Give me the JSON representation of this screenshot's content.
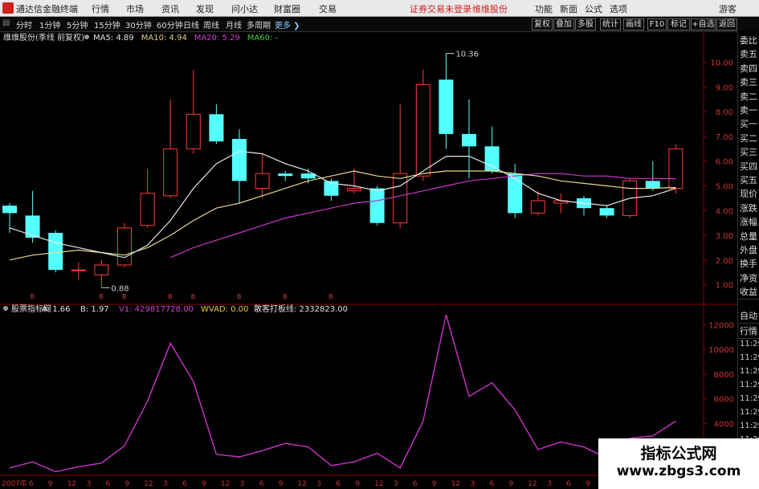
{
  "titlebar": {
    "app_name": "通达信金融终端",
    "menu": [
      "行情",
      "市场",
      "资讯",
      "发现",
      "问小达",
      "财富圈",
      "交易"
    ],
    "notice": "证券交易未登录",
    "stock_link": "维维股份",
    "right_menu": [
      "功能",
      "新面",
      "公式",
      "选项"
    ],
    "guest": "游客"
  },
  "toolbar": {
    "periods": [
      "分时",
      "1分钟",
      "5分钟",
      "15分钟",
      "30分钟",
      "60分钟",
      "日线",
      "周线",
      "月线",
      "多周期"
    ],
    "more": "更多",
    "right_buttons": [
      "复权",
      "叠加",
      "多股",
      "统计",
      "画线",
      "F10",
      "标记",
      "+自选",
      "返回"
    ]
  },
  "main_panel": {
    "legend": [
      {
        "text": "维维股份(季线 前复权)",
        "color": "#dddddd"
      },
      {
        "text": "MA5: 4.89",
        "color": "#e0e0e0"
      },
      {
        "text": "MA10: 4.94",
        "color": "#e0d080"
      },
      {
        "text": "MA20: 5.29",
        "color": "#d040d0"
      },
      {
        "text": "MA60: -",
        "color": "#40d040"
      }
    ],
    "max_label": "10.36",
    "min_label": "0.88",
    "markers": [
      1,
      4,
      5,
      7,
      8,
      10,
      12,
      14
    ],
    "colors": {
      "up": "#ff3c3c",
      "down": "#54ffff",
      "ma5": "#e6e6e6",
      "ma10": "#e6d88a",
      "ma20": "#cc33cc"
    }
  },
  "sub_panel": {
    "legend": [
      {
        "text": "股票指标网",
        "color": "#dddddd"
      },
      {
        "text": "A: 1.66",
        "color": "#e0e0e0"
      },
      {
        "text": "B: 1.97",
        "color": "#e0e0e0"
      },
      {
        "text": "V1: 429817728.00",
        "color": "#d040d0"
      },
      {
        "text": "WVAD: 0.00",
        "color": "#e0d040"
      },
      {
        "text": "散客打板线: 2332823.00",
        "color": "#e0e0e0"
      }
    ],
    "color": "#cc33cc"
  },
  "x_axis": {
    "labels": [
      "2007年",
      "6",
      "9",
      "12",
      "3",
      "6",
      "9",
      "12",
      "3",
      "6",
      "9",
      "12",
      "3",
      "6",
      "9",
      "12",
      "3",
      "6",
      "9",
      "12",
      "3",
      "6",
      "9",
      "12",
      "3",
      "6",
      "9",
      "12",
      "3",
      "6",
      "9",
      "12"
    ]
  },
  "sidebar": {
    "items": [
      "委比",
      "卖五",
      "卖四",
      "卖三",
      "卖二",
      "卖一",
      "买一",
      "买二",
      "买三",
      "买四",
      "买五",
      "现价",
      "涨跌",
      "涨幅",
      "总量",
      "外盘",
      "换手",
      "净资",
      "收益"
    ],
    "bottom_items": [
      "自动",
      "行情"
    ],
    "times": [
      "11:29",
      "11:29",
      "11:29",
      "11:29",
      "11:29",
      "11:29",
      "11:29",
      "11:29",
      "11:29",
      "11:29"
    ]
  },
  "watermark": {
    "line1": "指标公式网",
    "line2": "www.zbgs3.com"
  },
  "chart_data": [
    {
      "type": "candlestick",
      "title": "维维股份(季线 前复权)",
      "ylim": [
        0.5,
        10.8
      ],
      "y_ticks": [
        1.0,
        2.0,
        3.0,
        4.0,
        5.0,
        6.0,
        7.0,
        8.0,
        9.0,
        10.0
      ],
      "y_tick_labels": [
        "1.00",
        "2.00",
        "3.00",
        "4.00",
        "5.00",
        "6.00",
        "7.00",
        "8.00",
        "9.00",
        "10.00"
      ],
      "candles": [
        {
          "o": 4.2,
          "c": 3.9,
          "h": 4.3,
          "l": 3.1
        },
        {
          "o": 3.8,
          "c": 2.9,
          "h": 4.8,
          "l": 2.7
        },
        {
          "o": 3.1,
          "c": 1.6,
          "h": 3.2,
          "l": 1.5
        },
        {
          "o": 1.6,
          "c": 1.6,
          "h": 1.9,
          "l": 1.2
        },
        {
          "o": 1.4,
          "c": 1.8,
          "h": 2.0,
          "l": 0.88
        },
        {
          "o": 1.8,
          "c": 3.3,
          "h": 3.5,
          "l": 1.7
        },
        {
          "o": 3.4,
          "c": 4.7,
          "h": 5.7,
          "l": 3.3
        },
        {
          "o": 4.6,
          "c": 6.5,
          "h": 8.5,
          "l": 4.5
        },
        {
          "o": 6.5,
          "c": 7.9,
          "h": 9.7,
          "l": 6.3
        },
        {
          "o": 7.9,
          "c": 6.8,
          "h": 8.3,
          "l": 6.7
        },
        {
          "o": 6.9,
          "c": 5.2,
          "h": 7.3,
          "l": 4.3
        },
        {
          "o": 4.9,
          "c": 5.5,
          "h": 6.3,
          "l": 4.5
        },
        {
          "o": 5.5,
          "c": 5.4,
          "h": 5.6,
          "l": 5.2
        },
        {
          "o": 5.5,
          "c": 5.3,
          "h": 5.7,
          "l": 5.1
        },
        {
          "o": 5.2,
          "c": 4.6,
          "h": 5.3,
          "l": 4.4
        },
        {
          "o": 4.8,
          "c": 4.9,
          "h": 5.7,
          "l": 4.7
        },
        {
          "o": 4.9,
          "c": 3.5,
          "h": 5.0,
          "l": 3.4
        },
        {
          "o": 3.5,
          "c": 5.5,
          "h": 8.3,
          "l": 3.3
        },
        {
          "o": 5.4,
          "c": 9.1,
          "h": 9.7,
          "l": 5.2
        },
        {
          "o": 9.3,
          "c": 7.1,
          "h": 10.36,
          "l": 6.5
        },
        {
          "o": 7.1,
          "c": 6.6,
          "h": 8.5,
          "l": 5.3
        },
        {
          "o": 6.6,
          "c": 5.6,
          "h": 7.4,
          "l": 5.5
        },
        {
          "o": 5.5,
          "c": 3.9,
          "h": 5.9,
          "l": 3.7
        },
        {
          "o": 3.9,
          "c": 4.4,
          "h": 4.8,
          "l": 3.8
        },
        {
          "o": 4.3,
          "c": 4.4,
          "h": 4.7,
          "l": 3.9
        },
        {
          "o": 4.5,
          "c": 4.1,
          "h": 4.6,
          "l": 3.8
        },
        {
          "o": 4.1,
          "c": 3.8,
          "h": 4.2,
          "l": 3.7
        },
        {
          "o": 3.8,
          "c": 5.2,
          "h": 5.3,
          "l": 3.7
        },
        {
          "o": 5.2,
          "c": 4.9,
          "h": 6.0,
          "l": 4.8
        },
        {
          "o": 4.9,
          "c": 6.5,
          "h": 6.7,
          "l": 4.7
        }
      ],
      "ma5": [
        3.3,
        3.0,
        2.7,
        2.5,
        2.3,
        2.1,
        2.6,
        3.6,
        4.9,
        5.9,
        6.4,
        6.3,
        5.9,
        5.6,
        5.1,
        5.0,
        4.8,
        5.0,
        5.6,
        6.2,
        6.2,
        5.8,
        5.3,
        4.7,
        4.4,
        4.3,
        4.2,
        4.5,
        4.6,
        4.9
      ],
      "ma10": [
        2.0,
        2.2,
        2.3,
        2.4,
        2.3,
        2.2,
        2.5,
        3.0,
        3.6,
        4.1,
        4.3,
        4.6,
        4.9,
        5.2,
        5.4,
        5.6,
        5.4,
        5.3,
        5.5,
        5.6,
        5.6,
        5.6,
        5.5,
        5.4,
        5.2,
        5.1,
        5.0,
        4.9,
        4.9,
        4.94
      ],
      "ma20": [
        null,
        null,
        null,
        null,
        null,
        null,
        null,
        2.1,
        2.5,
        2.8,
        3.1,
        3.4,
        3.7,
        3.9,
        4.1,
        4.3,
        4.4,
        4.6,
        4.8,
        5.0,
        5.2,
        5.3,
        5.4,
        5.5,
        5.5,
        5.4,
        5.4,
        5.3,
        5.3,
        5.29
      ]
    },
    {
      "type": "line",
      "title": "股票指标网",
      "ylim": [
        0,
        13000
      ],
      "y_ticks": [
        4000,
        6000,
        8000,
        10000,
        12000
      ],
      "y_tick_labels": [
        "4000",
        "6000",
        "8000",
        "10000",
        "12000"
      ],
      "values": [
        400,
        900,
        100,
        500,
        800,
        2200,
        5800,
        10500,
        7400,
        1500,
        1300,
        1800,
        2400,
        2100,
        600,
        900,
        1600,
        400,
        4200,
        12800,
        6200,
        7300,
        5100,
        1900,
        2500,
        2100,
        1200,
        2800,
        3000,
        4200
      ]
    }
  ]
}
